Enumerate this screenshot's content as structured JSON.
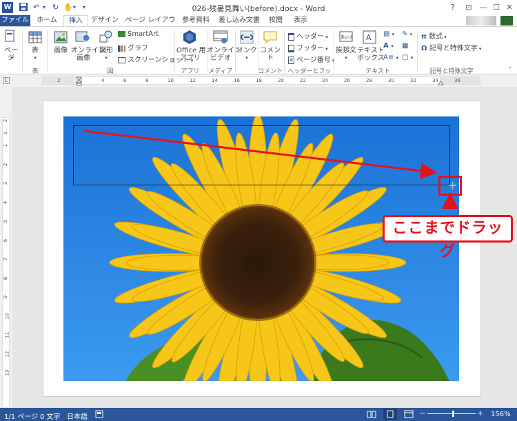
{
  "app": {
    "title": "026-残暑見舞い(before).docx - Word",
    "window_controls": {
      "help": "?",
      "ribbon_options": "⊡",
      "minimize": "—",
      "maximize": "☐",
      "close": "✕"
    }
  },
  "tabs": [
    "ファイル",
    "ホーム",
    "挿入",
    "デザイン",
    "ページ レイアウト",
    "参考資料",
    "差し込み文書",
    "校閲",
    "表示"
  ],
  "active_tab": "挿入",
  "ribbon": {
    "page": "ページ",
    "table": "表",
    "table_group": "表",
    "image": "画像",
    "online_image": "オンライン\n画像",
    "shapes": "図形",
    "smartart": "SmartArt",
    "chart": "グラフ",
    "screenshot": "スクリーンショット",
    "illust_group": "図",
    "office_apps": "Office 用\nアプリ",
    "apps_group": "アプリ",
    "online_video": "オンライン\nビデオ",
    "media_group": "メディア",
    "link": "リンク",
    "comment": "コメント",
    "comment_group": "コメント",
    "header": "ヘッダー",
    "footer": "フッター",
    "page_number": "ページ番号",
    "hf_group": "ヘッダーとフッター",
    "greeting": "挨拶文",
    "textbox": "テキスト\nボックス",
    "text_group": "テキスト",
    "equation": "数式",
    "symbol": "記号と特殊文字",
    "symbol_group": "記号と特殊文字"
  },
  "ruler": {
    "h_ticks": [
      "2",
      "2",
      "4",
      "6",
      "8",
      "10",
      "12",
      "14",
      "16",
      "18",
      "20",
      "22",
      "24",
      "26",
      "28",
      "30",
      "32",
      "34",
      "36"
    ],
    "v_ticks": [
      "2",
      "1",
      "1",
      "2",
      "3",
      "4",
      "5",
      "6",
      "7",
      "8",
      "9",
      "10",
      "11",
      "12",
      "13"
    ]
  },
  "annotation": {
    "callout": "ここまでドラッグ"
  },
  "status": {
    "page": "1/1 ページ",
    "words": "0 文字",
    "language": "日本語",
    "zoom": "156%"
  },
  "colors": {
    "accent": "#2b579a",
    "annotation_red": "#e8101c",
    "sky": "#1d7fdc"
  }
}
